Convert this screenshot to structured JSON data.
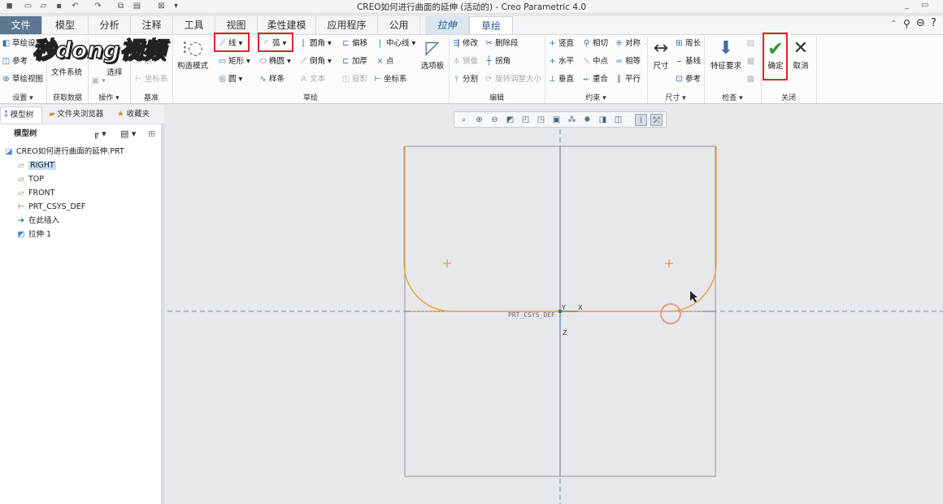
{
  "window": {
    "title": "CREO如何进行曲面的延伸 (活动的) - Creo Parametric 4.0"
  },
  "tabs": [
    {
      "label": "文件"
    },
    {
      "label": "模型"
    },
    {
      "label": "分析"
    },
    {
      "label": "注释"
    },
    {
      "label": "工具"
    },
    {
      "label": "视图"
    },
    {
      "label": "柔性建模"
    },
    {
      "label": "应用程序"
    },
    {
      "label": "公用"
    },
    {
      "label": "拉伸"
    },
    {
      "label": "草绘"
    }
  ],
  "watermark": "秒dong视频",
  "ribbon": {
    "setup": {
      "sketch_setup": "草绘设置",
      "reference": "参考",
      "sketch_view": "草绘视图",
      "group": "设置"
    },
    "get_data": {
      "file_system": "文件系统",
      "group": "获取数据"
    },
    "operations": {
      "select": "选择",
      "group": "操作"
    },
    "datum": {
      "point": "点",
      "csys": "坐标系",
      "group": "基准"
    },
    "sketch": {
      "construction_mode": "构造模式",
      "line": "线",
      "arc": "弧",
      "fillet": "圆角",
      "offset": "偏移",
      "centerline": "中心线",
      "rectangle": "矩形",
      "ellipse": "椭圆",
      "chamfer": "倒角",
      "thicken": "加厚",
      "point": "点",
      "circle": "圆",
      "spline": "样条",
      "text": "文本",
      "project": "投影",
      "csys": "坐标系",
      "palette": "选项板",
      "group": "草绘"
    },
    "edit": {
      "modify": "修改",
      "delete_segment": "删除段",
      "mirror": "镜像",
      "corner": "拐角",
      "divide": "分割",
      "rotate_resize": "旋转调整大小",
      "group": "编辑"
    },
    "constrain": {
      "vertical": "竖直",
      "tangent": "相切",
      "symmetric": "对称",
      "horizontal": "水平",
      "midpoint": "中点",
      "equal": "相等",
      "perpendicular": "垂直",
      "coincident": "重合",
      "parallel": "平行",
      "group": "约束"
    },
    "dimension": {
      "dimension": "尺寸",
      "perimeter": "周长",
      "baseline": "基线",
      "reference": "参考",
      "group": "尺寸"
    },
    "inspect": {
      "feature_requirements": "特征要求",
      "group": "检查"
    },
    "close": {
      "ok": "确定",
      "cancel": "取消",
      "group": "关闭"
    }
  },
  "panel": {
    "tabs": [
      {
        "label": "模型树"
      },
      {
        "label": "文件夹浏览器"
      },
      {
        "label": "收藏夹"
      }
    ],
    "tree_header": "模型树",
    "tree": [
      {
        "label": "CREO如何进行曲面的延伸.PRT"
      },
      {
        "label": "RIGHT"
      },
      {
        "label": "TOP"
      },
      {
        "label": "FRONT"
      },
      {
        "label": "PRT_CSYS_DEF"
      },
      {
        "label": "在此插入"
      },
      {
        "label": "拉伸 1"
      }
    ]
  },
  "canvas": {
    "csys_label": "PRT_CSYS_DEF",
    "axis_x": "X",
    "axis_y": "Y",
    "axis_z": "Z"
  },
  "colors": {
    "accent": "#2a5a8a",
    "file_tab": "#5d7791",
    "highlight": "#e0242a",
    "sketch": "#f0a030",
    "ok_green": "#2f9a3a"
  }
}
